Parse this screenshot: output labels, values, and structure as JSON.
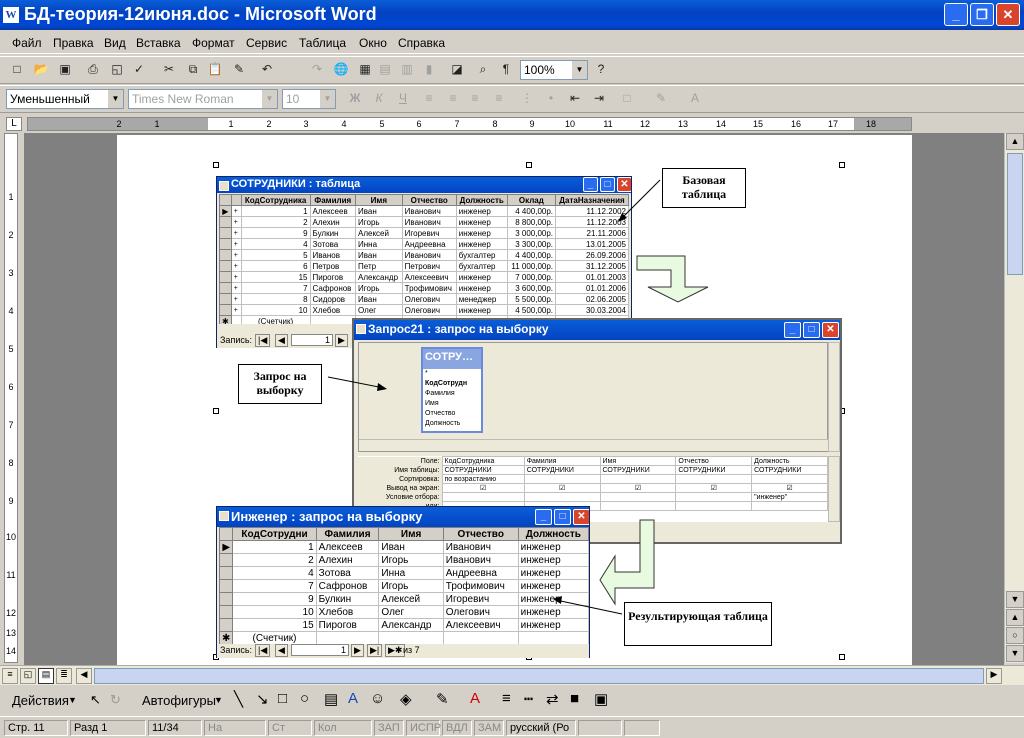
{
  "window": {
    "title": "БД-теория-12июня.doc - Microsoft Word",
    "app_icon": "W",
    "min": "_",
    "max": "❐",
    "close": "✕"
  },
  "menu": [
    "Файл",
    "Правка",
    "Вид",
    "Вставка",
    "Формат",
    "Сервис",
    "Таблица",
    "Окно",
    "Справка"
  ],
  "toolbar": {
    "zoom": "100%"
  },
  "formatting": {
    "style": "Уменьшенный",
    "font": "Times New Roman",
    "size": "10",
    "bold": "Ж",
    "italic": "К",
    "underline": "Ч"
  },
  "ruler": {
    "numbers": [
      "2",
      "1",
      "1",
      "2",
      "3",
      "4",
      "5",
      "6",
      "7",
      "8",
      "9",
      "10",
      "11",
      "12",
      "13",
      "14",
      "15",
      "16",
      "17",
      "18"
    ],
    "vnumbers": [
      "1",
      "2",
      "3",
      "4",
      "5",
      "6",
      "7",
      "8",
      "9",
      "10",
      "11",
      "12",
      "13",
      "14"
    ]
  },
  "table_window": {
    "title": "СОТРУДНИКИ : таблица",
    "columns": [
      "КодСотрудника",
      "Фамилия",
      "Имя",
      "Отчество",
      "Должность",
      "Оклад",
      "ДатаНазначения"
    ],
    "rows": [
      [
        "1",
        "Алексеев",
        "Иван",
        "Иванович",
        "инженер",
        "4 400,00р.",
        "11.12.2002"
      ],
      [
        "2",
        "Алехин",
        "Игорь",
        "Иванович",
        "инженер",
        "8 800,00р.",
        "11.12.2003"
      ],
      [
        "9",
        "Булкин",
        "Алексей",
        "Игоревич",
        "инженер",
        "3 000,00р.",
        "21.11.2006"
      ],
      [
        "4",
        "Зотова",
        "Инна",
        "Андреевна",
        "инженер",
        "3 300,00р.",
        "13.01.2005"
      ],
      [
        "5",
        "Иванов",
        "Иван",
        "Иванович",
        "бухгалтер",
        "4 400,00р.",
        "26.09.2006"
      ],
      [
        "6",
        "Петров",
        "Петр",
        "Петрович",
        "бухгалтер",
        "11 000,00р.",
        "31.12.2005"
      ],
      [
        "15",
        "Пирогов",
        "Александр",
        "Алексеевич",
        "инженер",
        "7 000,00р.",
        "01.01.2003"
      ],
      [
        "7",
        "Сафронов",
        "Игорь",
        "Трофимович",
        "инженер",
        "3 600,00р.",
        "01.01.2006"
      ],
      [
        "8",
        "Сидоров",
        "Иван",
        "Олегович",
        "менеджер",
        "5 500,00р.",
        "02.06.2005"
      ],
      [
        "10",
        "Хлебов",
        "Олег",
        "Олегович",
        "инженер",
        "4 500,00р.",
        "30.03.2004"
      ]
    ],
    "new_row": "(Счетчик)",
    "nav_label": "Запись:",
    "nav_value": "1"
  },
  "query_window": {
    "title": "Запрос21 : запрос на выборку",
    "table_box_title": "СОТРУ…",
    "fields": [
      "*",
      "КодСотрудн",
      "Фамилия",
      "Имя",
      "Отчество",
      "Должность"
    ],
    "row_labels": [
      "Поле:",
      "Имя таблицы:",
      "Сортировка:",
      "Вывод на экран:",
      "Условие отбора:",
      "или:"
    ],
    "columns": [
      {
        "field": "КодСотрудника",
        "table": "СОТРУДНИКИ",
        "sort": "по возрастанию",
        "show": "☑",
        "cond": ""
      },
      {
        "field": "Фамилия",
        "table": "СОТРУДНИКИ",
        "sort": "",
        "show": "☑",
        "cond": ""
      },
      {
        "field": "Имя",
        "table": "СОТРУДНИКИ",
        "sort": "",
        "show": "☑",
        "cond": ""
      },
      {
        "field": "Отчество",
        "table": "СОТРУДНИКИ",
        "sort": "",
        "show": "☑",
        "cond": ""
      },
      {
        "field": "Должность",
        "table": "СОТРУДНИКИ",
        "sort": "",
        "show": "☑",
        "cond": "\"инженер\""
      }
    ]
  },
  "result_window": {
    "title": "Инженер : запрос на выборку",
    "columns": [
      "КодСотрудни",
      "Фамилия",
      "Имя",
      "Отчество",
      "Должность"
    ],
    "rows": [
      [
        "1",
        "Алексеев",
        "Иван",
        "Иванович",
        "инженер"
      ],
      [
        "2",
        "Алехин",
        "Игорь",
        "Иванович",
        "инженер"
      ],
      [
        "4",
        "Зотова",
        "Инна",
        "Андреевна",
        "инженер"
      ],
      [
        "7",
        "Сафронов",
        "Игорь",
        "Трофимович",
        "инженер"
      ],
      [
        "9",
        "Булкин",
        "Алексей",
        "Игоревич",
        "инженер"
      ],
      [
        "10",
        "Хлебов",
        "Олег",
        "Олегович",
        "инженер"
      ],
      [
        "15",
        "Пирогов",
        "Александр",
        "Алексеевич",
        "инженер"
      ]
    ],
    "new_row": "(Счетчик)",
    "nav_label": "Запись:",
    "nav_value": "1",
    "nav_total": "из 7"
  },
  "callouts": {
    "base": "Базовая таблица",
    "query": "Запрос на выборку",
    "result": "Результирующая таблица"
  },
  "drawing": {
    "actions": "Действия",
    "autoshapes": "Автофигуры"
  },
  "status": {
    "page": "Стр.  11",
    "section": "Разд  1",
    "pages": "11/34",
    "at": "На",
    "line": "Ст",
    "col": "Кол",
    "rec": "ЗАП",
    "trk": "ИСПР",
    "ext": "ВДЛ",
    "ovr": "ЗАМ",
    "lang": "русский (Ро"
  },
  "colors": {
    "titlebar": "#0343c2",
    "arrow_fill": "#e8fbe0",
    "close": "#d8452c"
  }
}
